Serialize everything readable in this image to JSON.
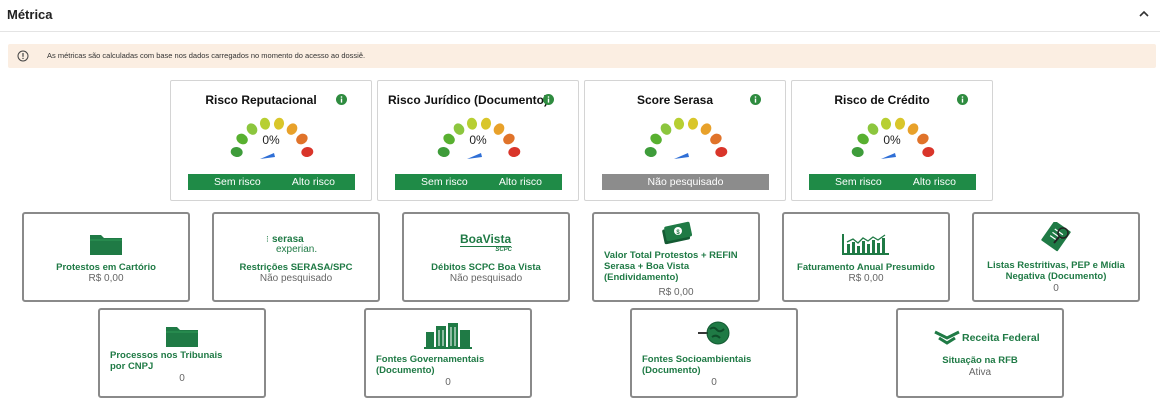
{
  "section": {
    "title": "Métrica"
  },
  "notice": {
    "text": "As métricas são calculadas com base nos dados carregados no momento do acesso ao dossiê."
  },
  "gauges": [
    {
      "title": "Risco Reputacional",
      "percent": "0%",
      "low_label": "Sem risco",
      "high_label": "Alto risco"
    },
    {
      "title": "Risco Jurídico (Documento)",
      "percent": "0%",
      "low_label": "Sem risco",
      "high_label": "Alto risco"
    },
    {
      "title": "Score Serasa",
      "status": "Não pesquisado"
    },
    {
      "title": "Risco de Crédito",
      "percent": "0%",
      "low_label": "Sem risco",
      "high_label": "Alto risco"
    }
  ],
  "cards_row1": [
    {
      "label": "Protestos em Cartório",
      "value": "R$ 0,00",
      "icon": "folder-icon"
    },
    {
      "label": "Restrições SERASA/SPC",
      "value": "Não pesquisado",
      "icon": "serasa-experian-logo",
      "logo_line1": "serasa",
      "logo_line2": "experian."
    },
    {
      "label": "Débitos SCPC Boa Vista",
      "value": "Não pesquisado",
      "icon": "boavista-logo",
      "logo_line1": "BoaVista",
      "logo_line2": "SCPC"
    },
    {
      "label": "Valor Total Protestos + REFIN Serasa + Boa Vista (Endividamento)",
      "value": "R$ 0,00",
      "icon": "money-icon"
    },
    {
      "label": "Faturamento Anual Presumido",
      "value": "R$ 0,00",
      "icon": "bar-chart-icon"
    },
    {
      "label": "Listas Restritivas, PEP e Mídia Negativa (Documento)",
      "value": "0",
      "icon": "document-search-icon"
    }
  ],
  "cards_row2": [
    {
      "label": "Processos nos Tribunais por CNPJ",
      "value": "0",
      "icon": "folder-icon"
    },
    {
      "label": "Fontes Governamentais (Documento)",
      "value": "0",
      "icon": "government-building-icon"
    },
    {
      "label": "Fontes Socioambientais (Documento)",
      "value": "0",
      "icon": "globe-search-icon"
    },
    {
      "label": "Situação na RFB",
      "value": "Ativa",
      "icon": "receita-federal-logo",
      "logo_text": "Receita Federal"
    }
  ],
  "colors": {
    "accent_green": "#1f7a45",
    "bar_green": "#1f8b47",
    "notice_bg": "#fbeee2",
    "needle_blue": "#2f6fd6"
  }
}
